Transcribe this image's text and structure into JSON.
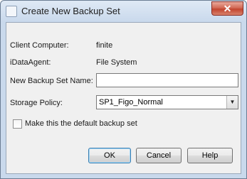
{
  "window": {
    "title": "Create New Backup Set",
    "close_glyph": "✕"
  },
  "form": {
    "client_label": "Client Computer:",
    "client_value": "finite",
    "agent_label": "iDataAgent:",
    "agent_value": "File System",
    "name_label": "New Backup Set Name:",
    "name_value": "",
    "policy_label": "Storage Policy:",
    "policy_value": "SP1_Figo_Normal",
    "default_label": "Make this the default backup set",
    "default_checked": false
  },
  "buttons": {
    "ok": "OK",
    "cancel": "Cancel",
    "help": "Help"
  }
}
